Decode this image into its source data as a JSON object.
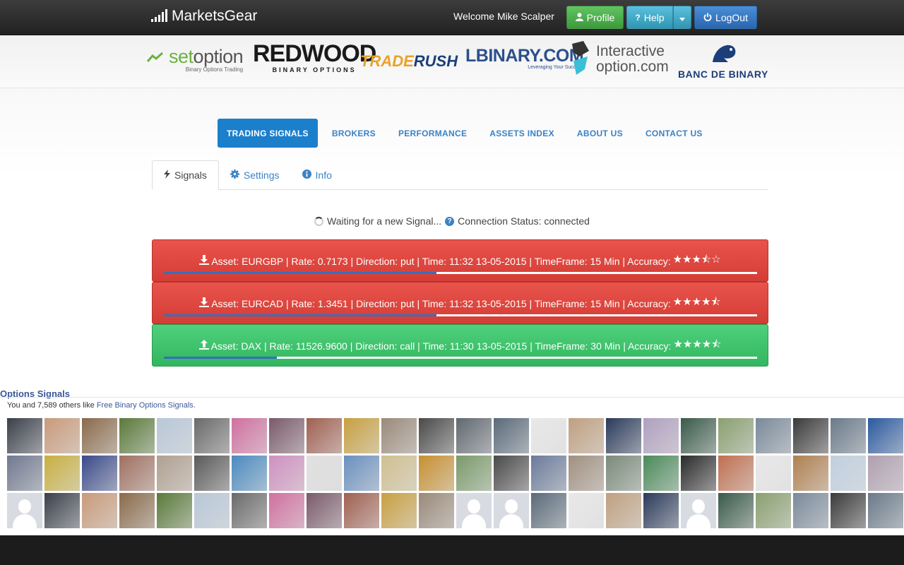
{
  "header": {
    "brand": "MarketsGear",
    "welcome": "Welcome Mike Scalper",
    "profile_label": "Profile",
    "help_label": "Help",
    "logout_label": "LogOut"
  },
  "brokers": {
    "setoption": {
      "name_a": "set",
      "name_b": "option",
      "tagline": "Binary Options Trading"
    },
    "redwood": {
      "name": "REDWOOD",
      "tagline": "BINARY OPTIONS"
    },
    "traderush": {
      "name_a": "TRADE",
      "name_b": "RUSH"
    },
    "lbinary": {
      "name": "LBINARY.COM",
      "tagline": "Leveraging Your Success"
    },
    "interactive": {
      "line1": "Interactive",
      "line2": "option.com"
    },
    "bancdebinary": {
      "name": "BANC DE BINARY"
    }
  },
  "nav": {
    "items": [
      "TRADING SIGNALS",
      "BROKERS",
      "PERFORMANCE",
      "ASSETS INDEX",
      "ABOUT US",
      "CONTACT US"
    ]
  },
  "tabs": {
    "signals": "Signals",
    "settings": "Settings",
    "info": "Info"
  },
  "status": {
    "waiting": "Waiting for a new Signal...",
    "connection": "Connection Status: connected"
  },
  "signals": [
    {
      "text": "Asset: EURGBP | Rate: 0.7173 | Direction: put | Time: 11:32 13-05-2015 | TimeFrame: 15 Min | Accuracy:",
      "stars": "★★★⯪☆",
      "direction": "put",
      "progress": 0.46,
      "color": "#d9443c"
    },
    {
      "text": "Asset: EURCAD | Rate: 1.3451 | Direction: put | Time: 11:32 13-05-2015 | TimeFrame: 15 Min | Accuracy:",
      "stars": "★★★★⯪",
      "direction": "put",
      "progress": 0.46,
      "color": "#d9443c"
    },
    {
      "text": "Asset: DAX | Rate: 11526.9600 | Direction: call | Time: 11:30 13-05-2015 | TimeFrame: 30 Min | Accuracy:",
      "stars": "★★★★⯪",
      "direction": "call",
      "progress": 0.19,
      "color": "#3cc06a"
    }
  ],
  "facebook": {
    "title": "Options Signals",
    "like_text": "You and 7,589 others like",
    "page_link": "Free Binary Options Signals."
  },
  "colors": {
    "accent": "#1c7fcc",
    "put": "#d9443c",
    "call": "#3cc06a",
    "profile_btn": "#4cae4c",
    "help_btn": "#39b3d7",
    "logout_btn": "#337ab7"
  }
}
